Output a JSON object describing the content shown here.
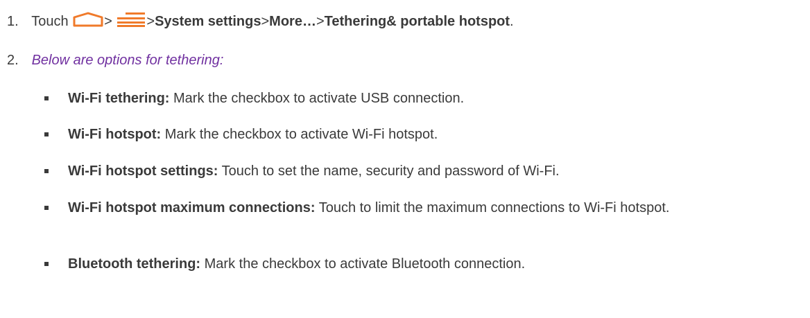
{
  "step1": {
    "number": "1.",
    "touch": "Touch",
    "sep1": ">",
    "sep2": ">",
    "system_settings": "System settings",
    "sep3": ">",
    "more": "More…",
    "sep4": ">",
    "tethering": "Tethering& portable hotspot",
    "period": ".",
    "icons": [
      "home-icon",
      "menu-icon"
    ],
    "icon_color": "#f07a2a"
  },
  "step2": {
    "number": "2.",
    "text": "Below are options for tethering:",
    "text_color": "#7030a0"
  },
  "options": [
    {
      "label": "Wi-Fi tethering:",
      "text": " Mark the checkbox to activate USB connection."
    },
    {
      "label": "Wi-Fi hotspot:",
      "text": " Mark the checkbox to activate Wi-Fi hotspot."
    },
    {
      "label": "Wi-Fi hotspot settings:",
      "text": " Touch to set the name, security and password of Wi-Fi."
    },
    {
      "label": "Wi-Fi hotspot maximum connections:",
      "text": " Touch to limit the maximum connections to Wi-Fi hotspot."
    },
    {
      "label": "Bluetooth tethering:",
      "text": " Mark the checkbox to activate Bluetooth connection."
    }
  ]
}
